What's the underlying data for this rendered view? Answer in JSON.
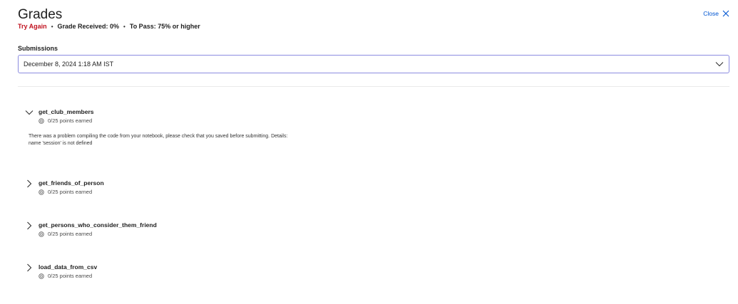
{
  "header": {
    "title": "Grades",
    "status": "Try Again",
    "grade_received": "Grade Received: 0%",
    "to_pass": "To Pass: 75% or higher",
    "close_label": "Close"
  },
  "submissions": {
    "label": "Submissions",
    "selected": "December 8, 2024 1:18 AM IST"
  },
  "items": [
    {
      "name": "get_club_members",
      "points": "0/25 points earned",
      "expanded": true,
      "detail_line1": "There was a problem compiling the code from your notebook, please check that you saved before submitting. Details:",
      "detail_line2": "name 'session' is not defined"
    },
    {
      "name": "get_friends_of_person",
      "points": "0/25 points earned",
      "expanded": false
    },
    {
      "name": "get_persons_who_consider_them_friend",
      "points": "0/25 points earned",
      "expanded": false
    },
    {
      "name": "load_data_from_csv",
      "points": "0/25 points earned",
      "expanded": false
    }
  ],
  "colors": {
    "accent": "#0056d2",
    "status": "#c1121f",
    "select_border": "#8c8ce0"
  }
}
